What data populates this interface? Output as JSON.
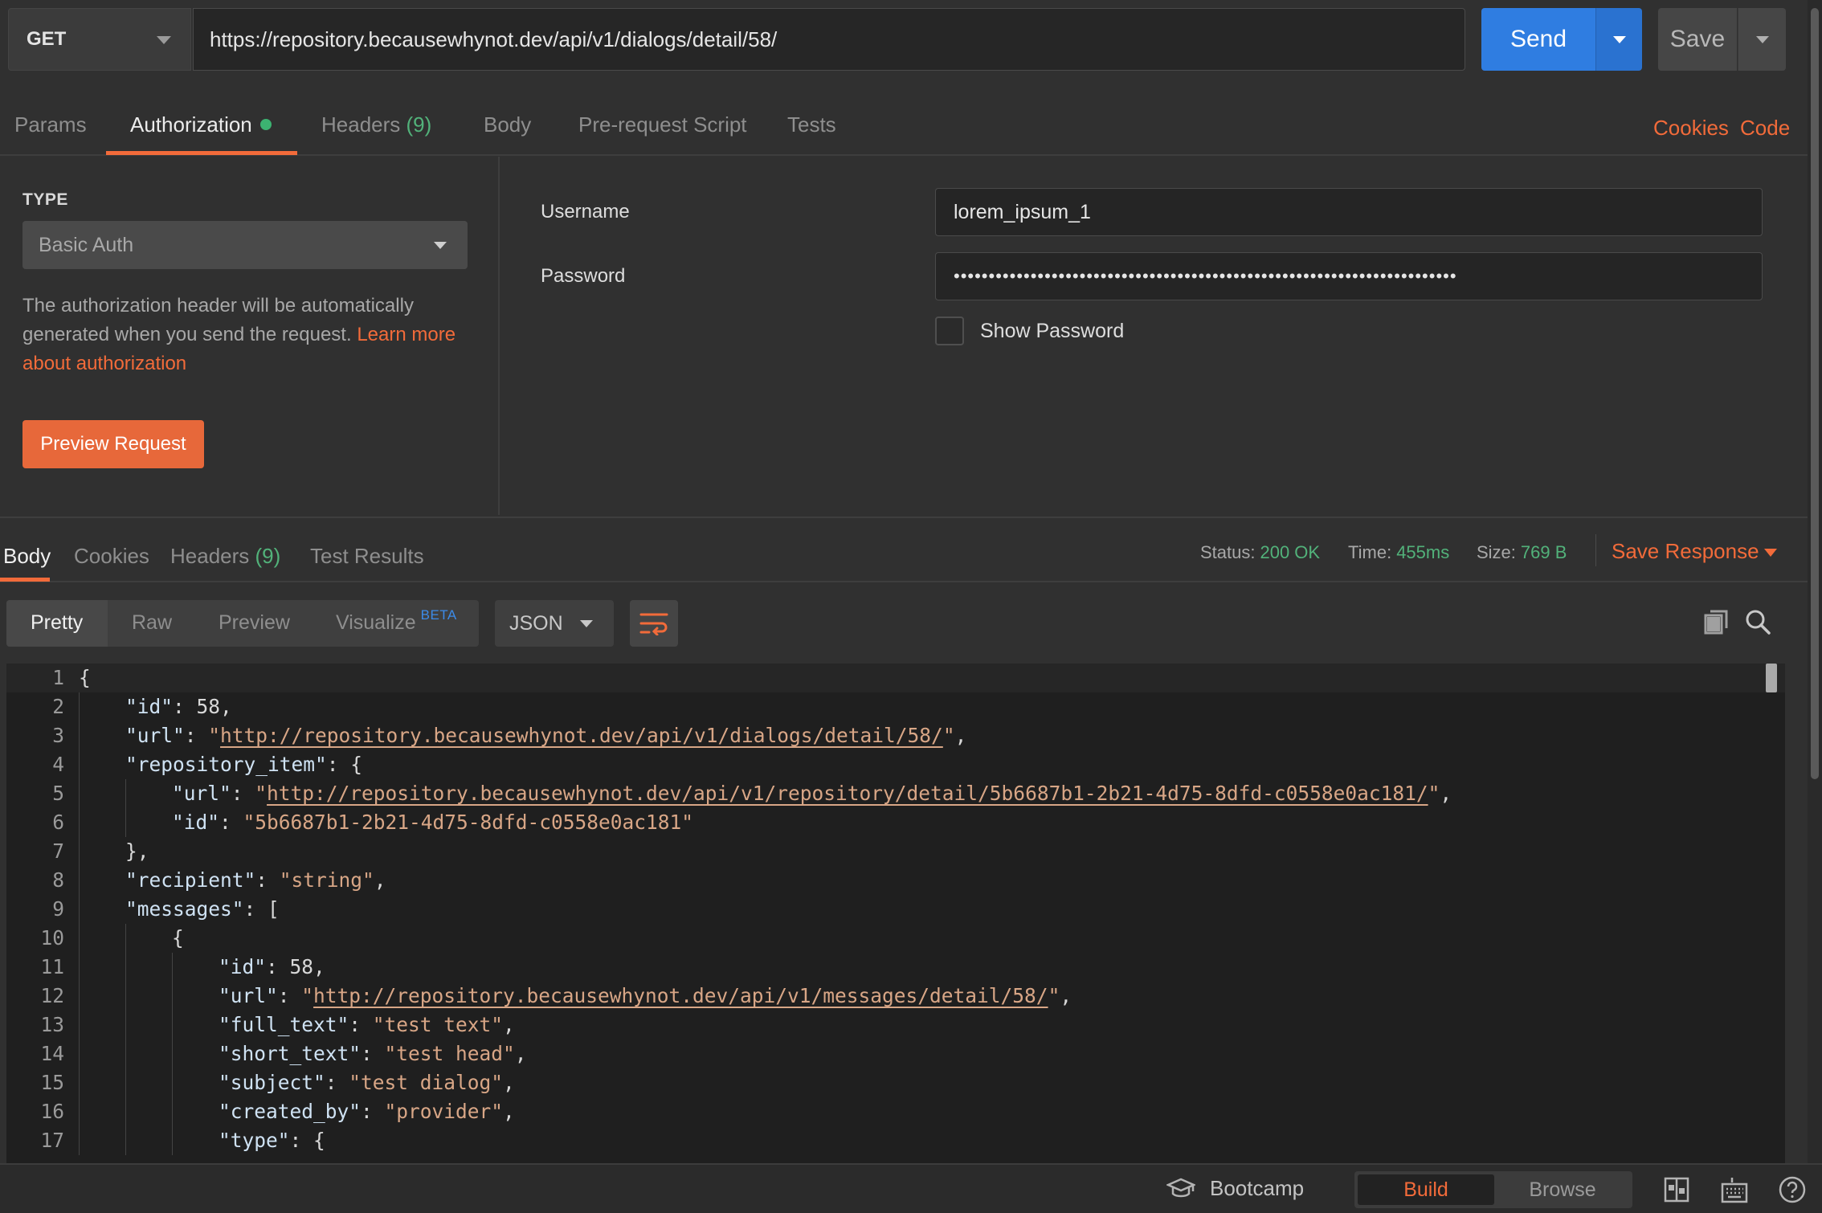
{
  "request": {
    "method": "GET",
    "url": "https://repository.becausewhynot.dev/api/v1/dialogs/detail/58/",
    "send_label": "Send",
    "save_label": "Save"
  },
  "req_tabs": {
    "params": "Params",
    "authorization": "Authorization",
    "headers": "Headers",
    "headers_count": "(9)",
    "body": "Body",
    "prerequest": "Pre-request Script",
    "tests": "Tests",
    "cookies": "Cookies",
    "code": "Code"
  },
  "auth": {
    "type_label": "TYPE",
    "type_value": "Basic Auth",
    "description": "The authorization header will be automatically generated when you send the request.",
    "learn_more": "Learn more about authorization",
    "preview_button": "Preview Request",
    "username_label": "Username",
    "username_value": "lorem_ipsum_1",
    "password_label": "Password",
    "password_value": "••••••••••••••••••••••••••••••••••••••••••••••••••••••••••••••••••••••••",
    "show_password_label": "Show Password"
  },
  "response": {
    "tabs": {
      "body": "Body",
      "cookies": "Cookies",
      "headers": "Headers",
      "headers_count": "(9)",
      "test_results": "Test Results"
    },
    "status_label": "Status:",
    "status_value": "200 OK",
    "time_label": "Time:",
    "time_value": "455ms",
    "size_label": "Size:",
    "size_value": "769 B",
    "save_response": "Save Response",
    "views": {
      "pretty": "Pretty",
      "raw": "Raw",
      "preview": "Preview",
      "visualize": "Visualize",
      "beta": "BETA"
    },
    "format": "JSON"
  },
  "code_lines": [
    {
      "n": "1",
      "indent": 0,
      "parts": [
        [
          "n",
          "{"
        ]
      ]
    },
    {
      "n": "2",
      "indent": 1,
      "parts": [
        [
          "k",
          "\"id\""
        ],
        [
          "n",
          ": "
        ],
        [
          "n",
          "58"
        ],
        [
          "n",
          ","
        ]
      ]
    },
    {
      "n": "3",
      "indent": 1,
      "parts": [
        [
          "k",
          "\"url\""
        ],
        [
          "n",
          ": "
        ],
        [
          "s",
          "\""
        ],
        [
          "u",
          "http://repository.becausewhynot.dev/api/v1/dialogs/detail/58/"
        ],
        [
          "s",
          "\""
        ],
        [
          "n",
          ","
        ]
      ]
    },
    {
      "n": "4",
      "indent": 1,
      "parts": [
        [
          "k",
          "\"repository_item\""
        ],
        [
          "n",
          ": {"
        ]
      ]
    },
    {
      "n": "5",
      "indent": 2,
      "parts": [
        [
          "k",
          "\"url\""
        ],
        [
          "n",
          ": "
        ],
        [
          "s",
          "\""
        ],
        [
          "u",
          "http://repository.becausewhynot.dev/api/v1/repository/detail/5b6687b1-2b21-4d75-8dfd-c0558e0ac181/"
        ],
        [
          "s",
          "\""
        ],
        [
          "n",
          ","
        ]
      ]
    },
    {
      "n": "6",
      "indent": 2,
      "parts": [
        [
          "k",
          "\"id\""
        ],
        [
          "n",
          ": "
        ],
        [
          "s",
          "\"5b6687b1-2b21-4d75-8dfd-c0558e0ac181\""
        ]
      ]
    },
    {
      "n": "7",
      "indent": 1,
      "parts": [
        [
          "n",
          "},"
        ]
      ]
    },
    {
      "n": "8",
      "indent": 1,
      "parts": [
        [
          "k",
          "\"recipient\""
        ],
        [
          "n",
          ": "
        ],
        [
          "s",
          "\"string\""
        ],
        [
          "n",
          ","
        ]
      ]
    },
    {
      "n": "9",
      "indent": 1,
      "parts": [
        [
          "k",
          "\"messages\""
        ],
        [
          "n",
          ": ["
        ]
      ]
    },
    {
      "n": "10",
      "indent": 2,
      "parts": [
        [
          "n",
          "{"
        ]
      ]
    },
    {
      "n": "11",
      "indent": 3,
      "parts": [
        [
          "k",
          "\"id\""
        ],
        [
          "n",
          ": "
        ],
        [
          "n",
          "58"
        ],
        [
          "n",
          ","
        ]
      ]
    },
    {
      "n": "12",
      "indent": 3,
      "parts": [
        [
          "k",
          "\"url\""
        ],
        [
          "n",
          ": "
        ],
        [
          "s",
          "\""
        ],
        [
          "u",
          "http://repository.becausewhynot.dev/api/v1/messages/detail/58/"
        ],
        [
          "s",
          "\""
        ],
        [
          "n",
          ","
        ]
      ]
    },
    {
      "n": "13",
      "indent": 3,
      "parts": [
        [
          "k",
          "\"full_text\""
        ],
        [
          "n",
          ": "
        ],
        [
          "s",
          "\"test text\""
        ],
        [
          "n",
          ","
        ]
      ]
    },
    {
      "n": "14",
      "indent": 3,
      "parts": [
        [
          "k",
          "\"short_text\""
        ],
        [
          "n",
          ": "
        ],
        [
          "s",
          "\"test head\""
        ],
        [
          "n",
          ","
        ]
      ]
    },
    {
      "n": "15",
      "indent": 3,
      "parts": [
        [
          "k",
          "\"subject\""
        ],
        [
          "n",
          ": "
        ],
        [
          "s",
          "\"test dialog\""
        ],
        [
          "n",
          ","
        ]
      ]
    },
    {
      "n": "16",
      "indent": 3,
      "parts": [
        [
          "k",
          "\"created_by\""
        ],
        [
          "n",
          ": "
        ],
        [
          "s",
          "\"provider\""
        ],
        [
          "n",
          ","
        ]
      ]
    },
    {
      "n": "17",
      "indent": 3,
      "parts": [
        [
          "k",
          "\"type\""
        ],
        [
          "n",
          ": {"
        ]
      ]
    }
  ],
  "status_bar": {
    "bootcamp": "Bootcamp",
    "build": "Build",
    "browse": "Browse"
  },
  "colors": {
    "accent": "#f26b3a",
    "send": "#2f7de1",
    "success": "#52b27a"
  }
}
